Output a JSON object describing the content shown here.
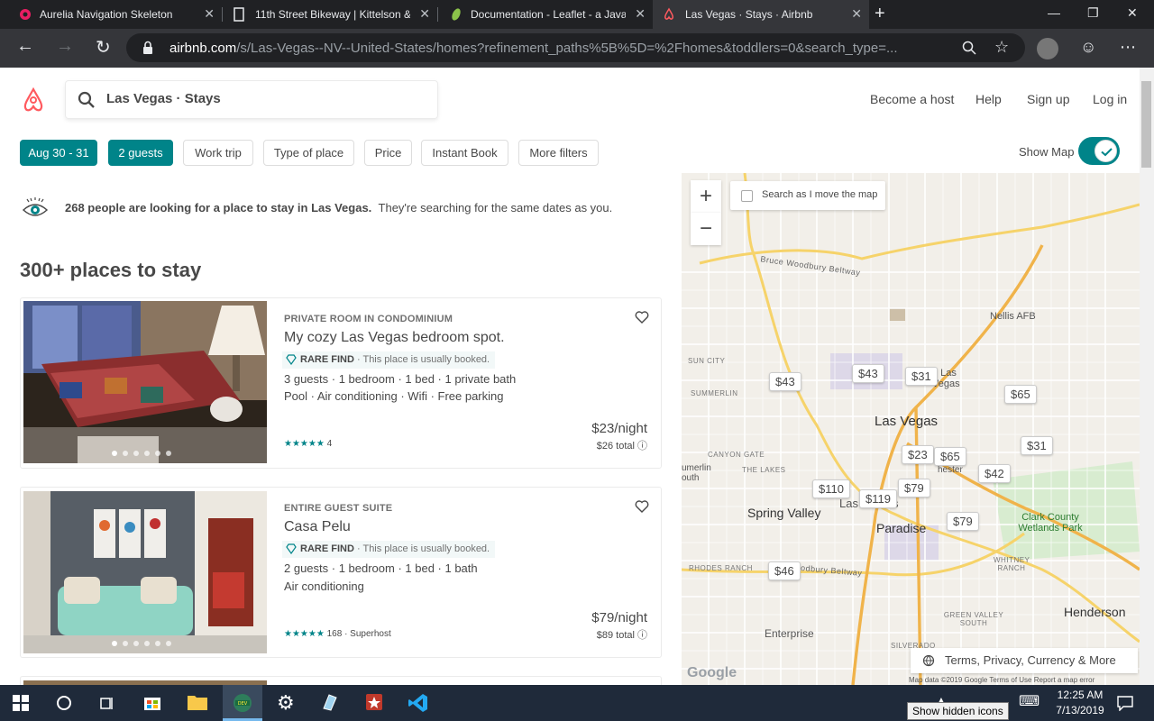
{
  "browser": {
    "tabs": [
      {
        "title": "Aurelia Navigation Skeleton",
        "close": "✕"
      },
      {
        "title": "11th Street Bikeway | Kittelson &",
        "close": "✕"
      },
      {
        "title": "Documentation - Leaflet - a Java",
        "close": "✕"
      },
      {
        "title": "Las Vegas · Stays · Airbnb",
        "close": "✕"
      }
    ],
    "new_tab": "+",
    "url_host": "airbnb.com",
    "url_rest": "/s/Las-Vegas--NV--United-States/homes?refinement_paths%5B%5D=%2Fhomes&toddlers=0&search_type=...",
    "colors": {
      "chrome_dark": "#202124",
      "chrome_active": "#35363a"
    }
  },
  "header": {
    "search_text": "Las Vegas · Stays",
    "nav": [
      "Become a host",
      "Help",
      "Sign up",
      "Log in"
    ],
    "brand_color": "#ff5a5f"
  },
  "filters": {
    "items": [
      "Aug 30 - 31",
      "2 guests",
      "Work trip",
      "Type of place",
      "Price",
      "Instant Book",
      "More filters"
    ],
    "show_map": "Show Map",
    "accent": "#008489"
  },
  "demand": {
    "bold": "268 people are looking for a place to stay in Las Vegas.",
    "rest": "They're searching for the same dates as you."
  },
  "results_title": "300+ places to stay",
  "listings": [
    {
      "kind": "PRIVATE ROOM IN CONDOMINIUM",
      "name": "My cozy Las Vegas bedroom spot.",
      "rare": "RARE FIND",
      "rare_sub": "· This place is usually booked.",
      "details1": "3 guests · 1 bedroom · 1 bed · 1 private bath",
      "details2": "Pool · Air conditioning · Wifi · Free parking",
      "stars": "★★★★★",
      "reviews": "4",
      "price": "$23/night",
      "total": "$26 total ⓘ"
    },
    {
      "kind": "ENTIRE GUEST SUITE",
      "name": "Casa Pelu",
      "rare": "RARE FIND",
      "rare_sub": "· This place is usually booked.",
      "details1": "2 guests · 1 bedroom · 1 bed · 1 bath",
      "details2": "Air conditioning",
      "stars": "★★★★★",
      "reviews": "168 · Superhost",
      "price": "$79/night",
      "total": "$89 total ⓘ"
    }
  ],
  "map": {
    "search_move": "Search as I move the map",
    "zoom_in": "+",
    "zoom_out": "−",
    "pins": [
      "$43",
      "$43",
      "$31",
      "$65",
      "$31",
      "$23",
      "$65",
      "$42",
      "$110",
      "$119",
      "$79",
      "$79",
      "$46"
    ],
    "labels": {
      "las_vegas": "Las Vegas",
      "spring_valley": "Spring Valley",
      "paradise": "Paradise",
      "henderson": "Henderson",
      "enterprise": "Enterprise",
      "nellis": "Nellis AFB",
      "clark": "Clark County Wetlands Park",
      "sun_city": "SUN CITY",
      "summerlin": "SUMMERLIN",
      "canyon_gate": "CANYON GATE",
      "the_lakes": "THE LAKES",
      "rhodes": "RHODES RANCH",
      "whitney": "WHITNEY RANCH",
      "green_valley": "GREEN VALLEY SOUTH",
      "silverado": "SILVERADO",
      "bruce": "Bruce Woodbury Beltway",
      "beltway_s": "odbury Beltway",
      "n_las_vegas": "h Las Vegas",
      "merlin": "umerlin outh",
      "chester": "hester",
      "las_s": "Las",
      "s_frag": "s"
    },
    "terms": "Terms, Privacy, Currency & More",
    "footer": "Map data ©2019 Google    Terms of Use    Report a map error",
    "google": "Google"
  },
  "taskbar": {
    "time": "12:25 AM",
    "date": "7/13/2019",
    "tooltip": "Show hidden icons"
  }
}
